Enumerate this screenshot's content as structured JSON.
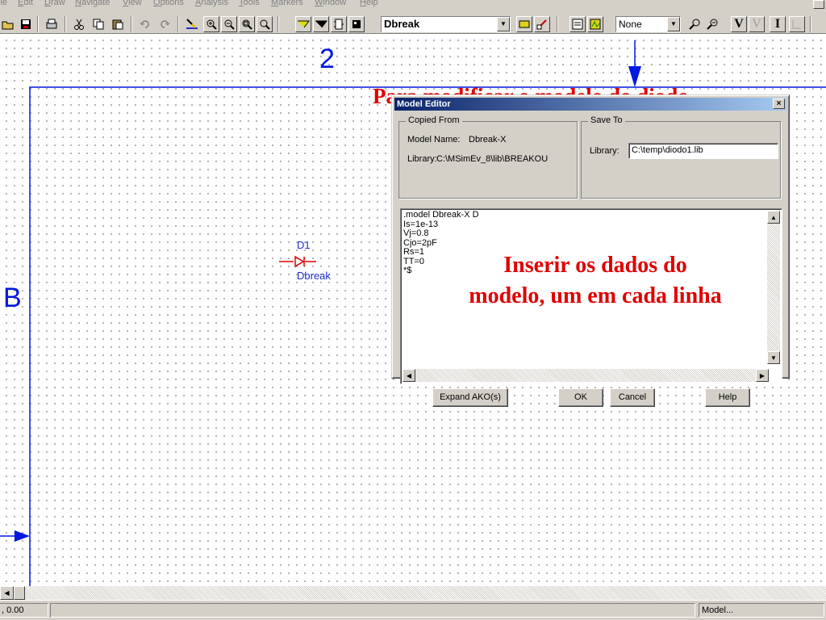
{
  "menu": {
    "items": [
      {
        "pre": "",
        "u": "",
        "post": "ile"
      },
      {
        "pre": "",
        "u": "E",
        "post": "dit"
      },
      {
        "pre": "",
        "u": "D",
        "post": "raw"
      },
      {
        "pre": "",
        "u": "N",
        "post": "avigate"
      },
      {
        "pre": "",
        "u": "V",
        "post": "iew"
      },
      {
        "pre": "",
        "u": "O",
        "post": "ptions"
      },
      {
        "pre": "",
        "u": "A",
        "post": "nalysis"
      },
      {
        "pre": "",
        "u": "T",
        "post": "ools"
      },
      {
        "pre": "",
        "u": "M",
        "post": "arkers"
      },
      {
        "pre": "",
        "u": "W",
        "post": "indow"
      },
      {
        "pre": "",
        "u": "H",
        "post": "elp"
      }
    ]
  },
  "toolbar": {
    "part_combo": "Dbreak",
    "none_combo": "None",
    "btn_v": "V",
    "btn_v2": "V",
    "btn_i": "I"
  },
  "canvas": {
    "col_label": "2",
    "row_label": "B",
    "annotation_top": "Para modificar o modelo do diodo",
    "annotation_center": "Inserir os dados do modelo, um em cada linha",
    "part_ref": "D1",
    "part_value": "Dbreak"
  },
  "dialog": {
    "title": "Model Editor",
    "close": "×",
    "copied_from": {
      "legend": "Copied From",
      "model_name_label": "Model Name:",
      "model_name_value": "Dbreak-X",
      "library_label": "Library:",
      "library_value": "C:\\MSimEv_8\\lib\\BREAKOU"
    },
    "save_to": {
      "legend": "Save To",
      "library_label": "Library:",
      "library_value": "C:\\temp\\diodo1.lib"
    },
    "model_text": ".model Dbreak-X D\nIs=1e-13\nVj=0.8\nCjo=2pF\nRs=1\nTT=0\n*$",
    "buttons": {
      "expand": "Expand AKO(s)",
      "ok": "OK",
      "cancel": "Cancel",
      "help": "Help"
    }
  },
  "status": {
    "coords": ", 0.00",
    "mode": "Model..."
  },
  "colors": {
    "wire": "#0018e0",
    "annotation": "#e00000",
    "part": "#e00000",
    "title_bar": "#0a246a"
  }
}
